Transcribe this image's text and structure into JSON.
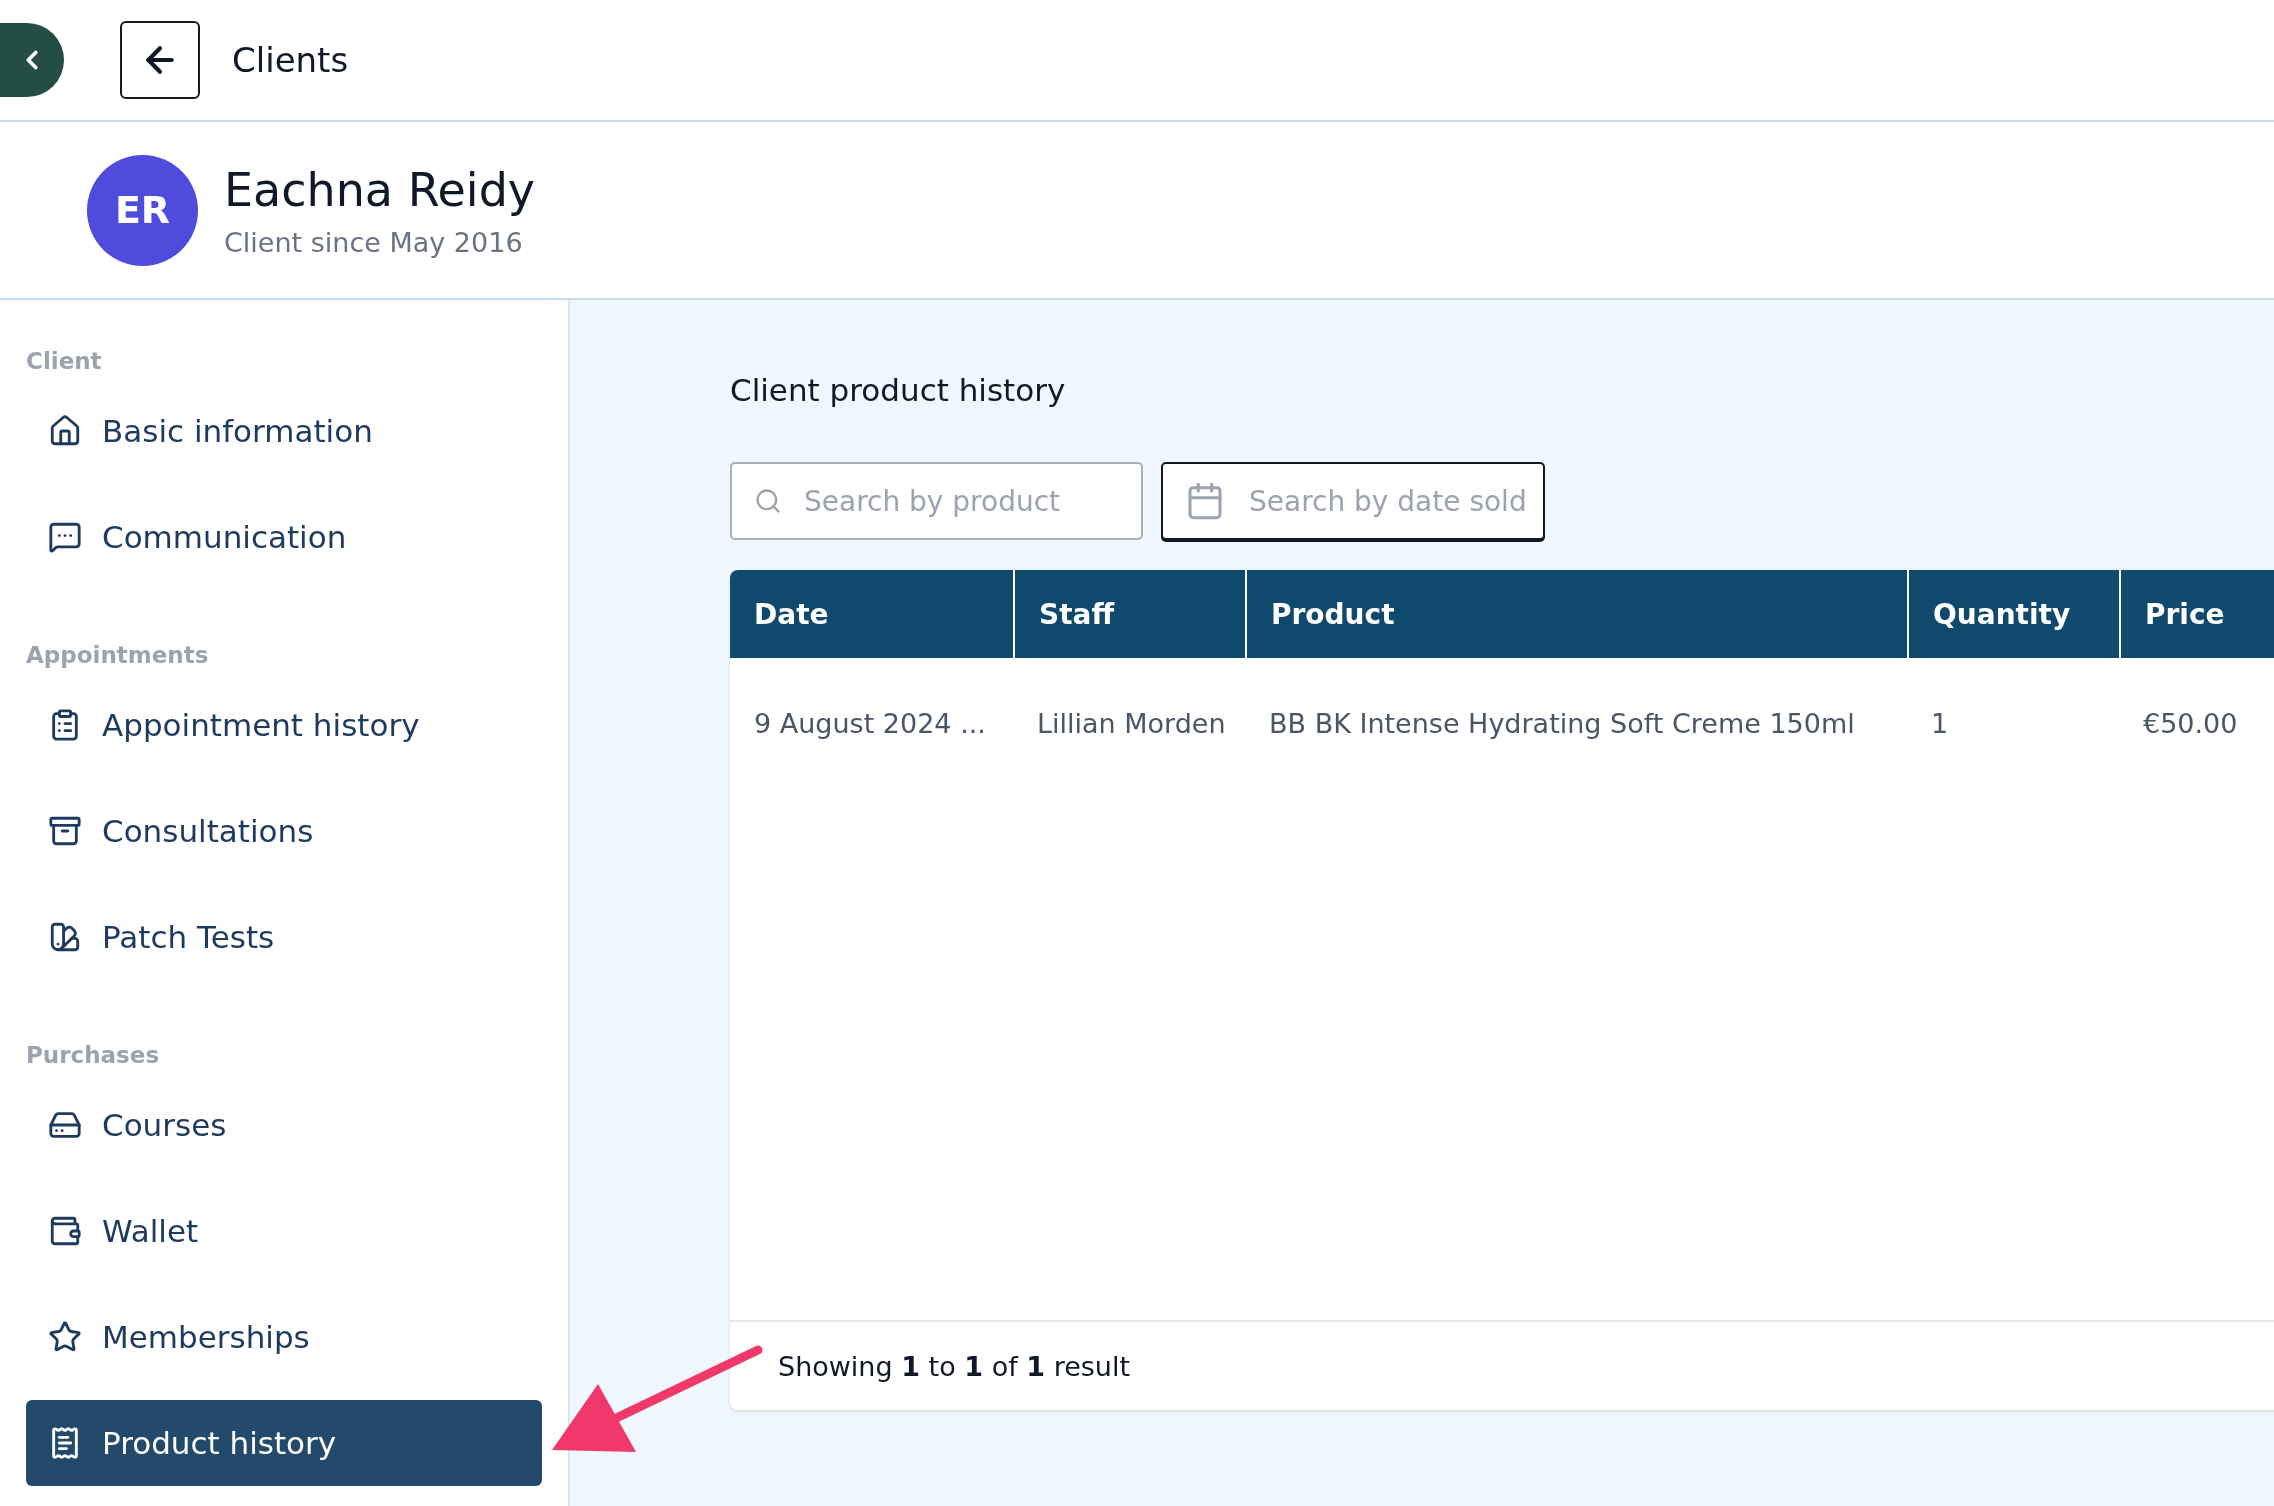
{
  "top_bar": {
    "title": "Clients"
  },
  "client": {
    "initials": "ER",
    "name": "Eachna Reidy",
    "subtitle": "Client since May 2016"
  },
  "sidebar": {
    "sections": [
      {
        "label": "Client",
        "items": [
          {
            "label": "Basic information",
            "selected": false
          },
          {
            "label": "Communication",
            "selected": false
          }
        ]
      },
      {
        "label": "Appointments",
        "items": [
          {
            "label": "Appointment history",
            "selected": false
          },
          {
            "label": "Consultations",
            "selected": false
          },
          {
            "label": "Patch Tests",
            "selected": false
          }
        ]
      },
      {
        "label": "Purchases",
        "items": [
          {
            "label": "Courses",
            "selected": false
          },
          {
            "label": "Wallet",
            "selected": false
          },
          {
            "label": "Memberships",
            "selected": false
          },
          {
            "label": "Product history",
            "selected": true
          }
        ]
      }
    ]
  },
  "main": {
    "title": "Client product history",
    "search": {
      "placeholder": "Search by product"
    },
    "date_search": {
      "placeholder": "Search by date sold"
    },
    "table": {
      "columns": [
        "Date",
        "Staff",
        "Product",
        "Quantity",
        "Price"
      ],
      "rows": [
        [
          "9 August 2024 ...",
          "Lillian Morden",
          "BB BK Intense Hydrating Soft Creme 150ml",
          "1",
          "€50.00"
        ]
      ]
    },
    "footer": "Showing **1** to **1** of **1** result"
  }
}
